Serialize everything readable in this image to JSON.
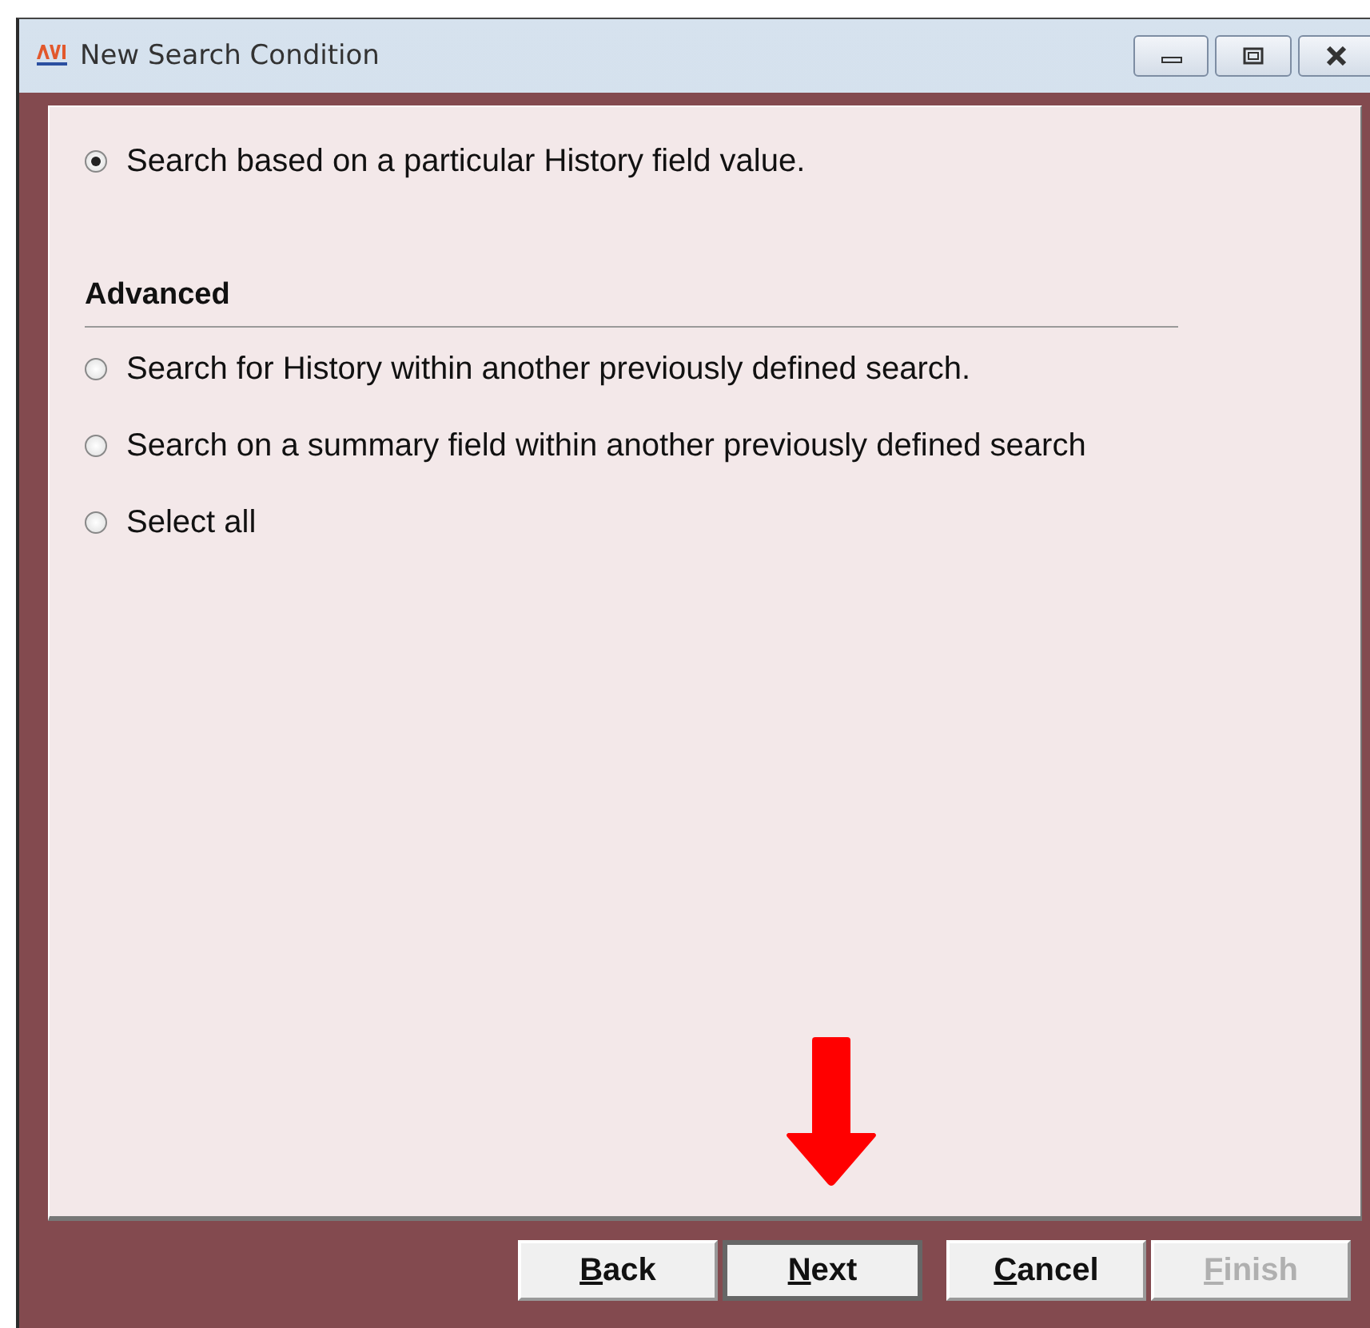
{
  "window": {
    "title": "New Search Condition"
  },
  "options": [
    {
      "label": "Search based on a particular History field value.",
      "selected": true
    }
  ],
  "advanced": {
    "heading": "Advanced",
    "options": [
      {
        "label": "Search for History within another previously defined search.",
        "selected": false
      },
      {
        "label": "Search on a summary field within another previously defined search",
        "selected": false
      },
      {
        "label": "Select all",
        "selected": false
      }
    ]
  },
  "buttons": [
    {
      "label": "Back",
      "mnemonic": true,
      "default": false,
      "disabled": false
    },
    {
      "label": "Next",
      "mnemonic": true,
      "default": true,
      "disabled": false
    },
    {
      "label": "Cancel",
      "mnemonic": true,
      "default": false,
      "disabled": false
    },
    {
      "label": "Finish",
      "mnemonic": true,
      "default": false,
      "disabled": true
    }
  ]
}
